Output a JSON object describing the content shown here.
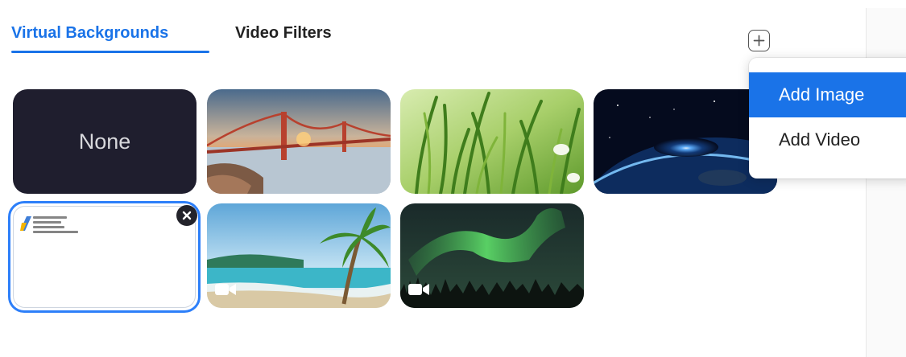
{
  "tabs": [
    {
      "label": "Virtual Backgrounds",
      "active": true
    },
    {
      "label": "Video Filters",
      "active": false
    }
  ],
  "add_button": {
    "icon": "plus-icon"
  },
  "backgrounds": [
    {
      "name": "None",
      "type": "none"
    },
    {
      "name": "Golden Gate Bridge",
      "type": "image"
    },
    {
      "name": "Grass",
      "type": "image"
    },
    {
      "name": "Earth from space",
      "type": "image"
    },
    {
      "name": "Custom document",
      "type": "image",
      "selected": true
    },
    {
      "name": "Beach",
      "type": "video"
    },
    {
      "name": "Aurora",
      "type": "video"
    }
  ],
  "none_tile": {
    "label": "None"
  },
  "menu": {
    "items": [
      {
        "label": "Add Image",
        "highlighted": true
      },
      {
        "label": "Add Video",
        "highlighted": false
      }
    ]
  },
  "colors": {
    "accent": "#1a73e8",
    "none_tile_bg": "#1f1e2e"
  }
}
